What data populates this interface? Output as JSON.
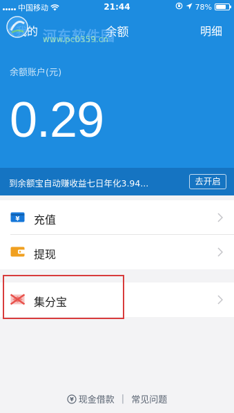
{
  "status_bar": {
    "carrier": "中国移动",
    "time": "21:44",
    "battery": "78%",
    "battery_level": 0.78
  },
  "nav": {
    "back_label": "我的",
    "title": "余额",
    "detail_label": "明细"
  },
  "watermark": {
    "site_name": "河东软件园",
    "url": "www.pc0359.cn"
  },
  "balance": {
    "label": "余额账户(元)",
    "amount": "0.29"
  },
  "promo": {
    "text": "到余额宝自动赚收益七日年化3.94...",
    "button_label": "去开启"
  },
  "menu": {
    "recharge": {
      "label": "充值",
      "icon": "yuan-card-icon"
    },
    "withdraw": {
      "label": "提现",
      "icon": "wallet-icon"
    },
    "jifenbao": {
      "label": "集分宝",
      "icon": "jifenbao-logo-icon"
    }
  },
  "footer": {
    "loan_label": "现金借款",
    "separator": "|",
    "faq_label": "常见问题"
  },
  "colors": {
    "header_blue": "#1d8ce0",
    "promo_blue": "#1574c2",
    "highlight_red": "#d83b3b",
    "recharge_icon": "#1677d8",
    "withdraw_icon": "#f0a020",
    "jifenbao_icon": "#e8504a"
  }
}
